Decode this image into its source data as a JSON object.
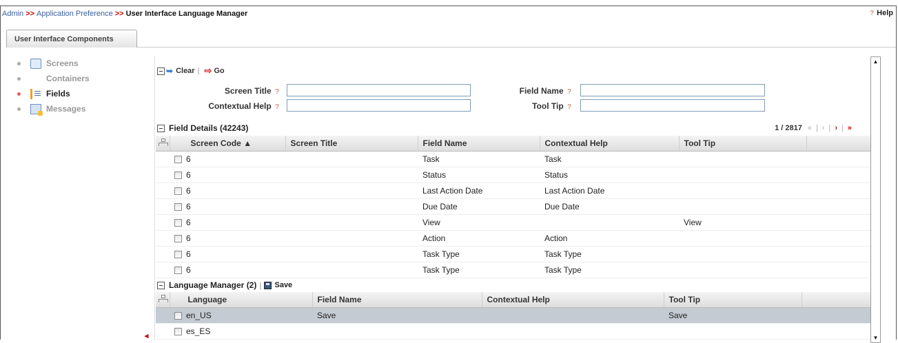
{
  "breadcrumb": {
    "items": [
      "Admin",
      "Application Preference"
    ],
    "separator": ">>",
    "current": "User Interface Language Manager"
  },
  "help": {
    "label": "Help",
    "glyph": "?"
  },
  "tab": {
    "label": "User Interface Components"
  },
  "nav": {
    "items": [
      {
        "label": "Screens"
      },
      {
        "label": "Containers"
      },
      {
        "label": "Fields"
      },
      {
        "label": "Messages"
      }
    ]
  },
  "toolbar": {
    "clear_label": "Clear",
    "separator": "|",
    "go_label": "Go"
  },
  "search": {
    "screen_title_label": "Screen Title",
    "field_name_label": "Field Name",
    "contextual_help_label": "Contextual Help",
    "tool_tip_label": "Tool Tip",
    "help_glyph": "?",
    "screen_title_value": "",
    "field_name_value": "",
    "contextual_help_value": "",
    "tool_tip_value": ""
  },
  "field_details": {
    "title": "Field Details (42243)",
    "pager": {
      "text": "1 / 2817",
      "first": "«",
      "prev": "‹",
      "next": "›",
      "last": "»",
      "sep": "|"
    },
    "columns": [
      "Screen Code ▲",
      "Screen Title",
      "Field Name",
      "Contextual Help",
      "Tool Tip"
    ],
    "rows": [
      {
        "screen_code": "6",
        "screen_title": "",
        "field_name": "Task",
        "contextual_help": "Task",
        "tool_tip": ""
      },
      {
        "screen_code": "6",
        "screen_title": "",
        "field_name": "Status",
        "contextual_help": "Status",
        "tool_tip": ""
      },
      {
        "screen_code": "6",
        "screen_title": "",
        "field_name": "Last Action Date",
        "contextual_help": "Last Action Date",
        "tool_tip": ""
      },
      {
        "screen_code": "6",
        "screen_title": "",
        "field_name": "Due Date",
        "contextual_help": "Due Date",
        "tool_tip": ""
      },
      {
        "screen_code": "6",
        "screen_title": "",
        "field_name": "View",
        "contextual_help": "",
        "tool_tip": "View"
      },
      {
        "screen_code": "6",
        "screen_title": "",
        "field_name": "Action",
        "contextual_help": "Action",
        "tool_tip": ""
      },
      {
        "screen_code": "6",
        "screen_title": "",
        "field_name": "Task Type",
        "contextual_help": "Task Type",
        "tool_tip": ""
      },
      {
        "screen_code": "6",
        "screen_title": "",
        "field_name": "Task Type",
        "contextual_help": "Task Type",
        "tool_tip": ""
      }
    ]
  },
  "language_manager": {
    "title": "Language Manager (2)",
    "separator": "|",
    "save_label": "Save",
    "columns": [
      "Language",
      "Field Name",
      "Contextual Help",
      "Tool Tip"
    ],
    "rows": [
      {
        "language": "en_US",
        "field_name": "Save",
        "contextual_help": "",
        "tool_tip": "Save",
        "selected": true
      },
      {
        "language": "es_ES",
        "field_name": "",
        "contextual_help": "",
        "tool_tip": "",
        "selected": false
      }
    ]
  },
  "scrollbar": {
    "up_glyph": "▲",
    "down_glyph": "▼"
  },
  "collapse_glyph": "◂"
}
